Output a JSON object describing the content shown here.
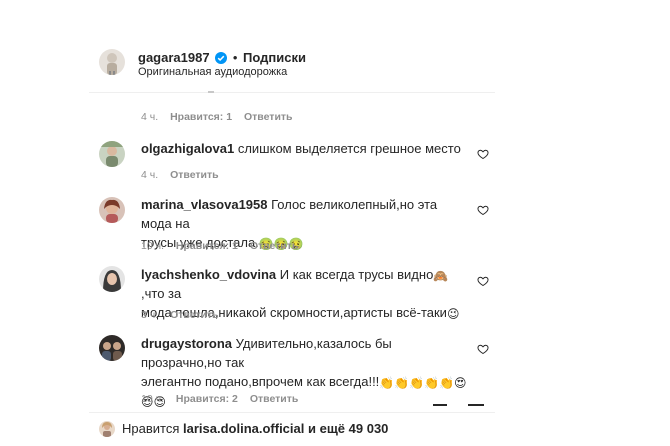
{
  "header": {
    "username": "gagara1987",
    "follow_label": "Подписки",
    "audio_label": "Оригинальная аудиодорожка",
    "separator": "•"
  },
  "prev_comment": {
    "time": "4 ч.",
    "likes": "Нравится: 1",
    "reply": "Ответить"
  },
  "comments": [
    {
      "username": "olgazhigalova1",
      "line1": "слишком выделяется грешное место",
      "time": "4 ч.",
      "reply": "Ответить"
    },
    {
      "username": "marina_vlasova1958",
      "line1": "Голос великолепный,но эта мода на",
      "line2": "трусы уже достала.",
      "line2_emoji": "🤢🤢🤢",
      "time": "10 ч.",
      "likes": "Нравится: 1",
      "reply": "Ответить"
    },
    {
      "username": "lyachshenko_vdovina",
      "line1_a": "И как всегда трусы видно",
      "line1_emoji": "🙈",
      "line1_b": ",что за",
      "line2": "мода пошла,никакой скромности,артисты всё-таки",
      "line2_emoji": "😉",
      "time": "3 ч.",
      "reply": "Ответить"
    },
    {
      "username": "drugaystorona",
      "line1": "Удивительно,казалось бы прозрачно,но так",
      "line2": "элегантно подано,впрочем как всегда!!!",
      "line2_emoji": "👏👏👏👏👏😍",
      "line3_emoji": "😍😍",
      "time": "10 ч.",
      "likes": "Нравится: 2",
      "reply": "Ответить"
    }
  ],
  "footer": {
    "likes_prefix": "Нравится",
    "liked_by": "larisa.dolina.official",
    "likes_suffix": "и ещё 49 030"
  },
  "colors": {
    "verified": "#0095f6",
    "secondary_text": "#8e8e8e",
    "divider": "#dbdbdb"
  },
  "icons": {
    "verified": "verified-badge-icon",
    "like": "heart-icon"
  }
}
